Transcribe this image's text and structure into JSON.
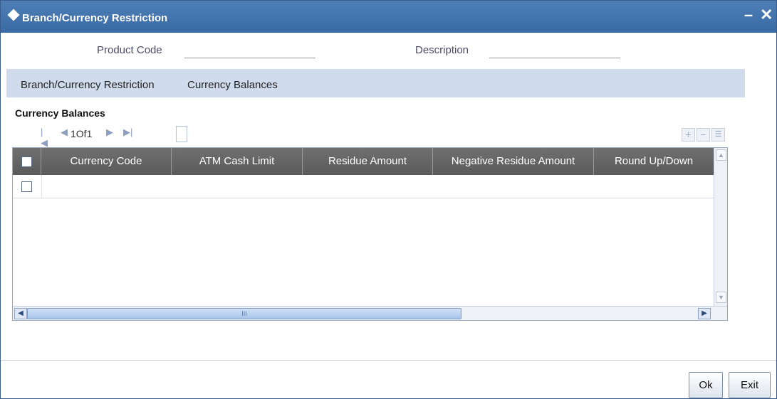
{
  "window": {
    "title": "Branch/Currency Restriction",
    "minimize_glyph": "–",
    "close_glyph": "✕"
  },
  "header": {
    "product_code_label": "Product Code",
    "product_code_value": "",
    "description_label": "Description",
    "description_value": ""
  },
  "tabs": [
    {
      "label": "Branch/Currency Restriction"
    },
    {
      "label": "Currency Balances"
    }
  ],
  "section": {
    "title": "Currency Balances"
  },
  "pager": {
    "text": "1Of1"
  },
  "grid": {
    "columns": [
      "Currency Code",
      "ATM Cash Limit",
      "Residue Amount",
      "Negative Residue Amount",
      "Round Up/Down"
    ],
    "rows": [
      [
        "",
        "",
        "",
        "",
        ""
      ]
    ],
    "scroll_grip": "III"
  },
  "footer": {
    "ok_label": "Ok",
    "exit_label": "Exit"
  }
}
